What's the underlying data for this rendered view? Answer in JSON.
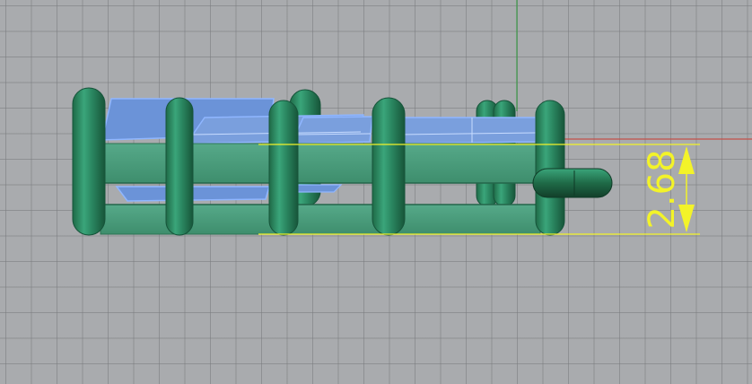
{
  "viewport": {
    "grid_color": "#7f8185",
    "background_color": "#a9abae",
    "x_axis_color": "#c3504a",
    "y_axis_color": "#3f9a4a"
  },
  "model": {
    "fence_color": "#2f8a62",
    "panel_color": "#6b93d8",
    "selection_edge_color": "#8fb6ff"
  },
  "dimension": {
    "value": "2.68",
    "color": "#f3f329"
  }
}
